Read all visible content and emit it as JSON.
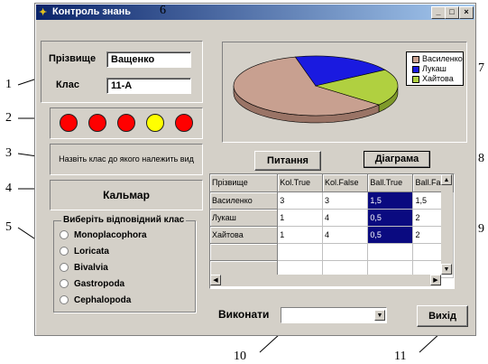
{
  "window": {
    "title": "Контроль знань",
    "controls": [
      "_",
      "□",
      "×"
    ]
  },
  "form": {
    "surname_label": "Прізвище",
    "surname_value": "Ващенко",
    "class_label": "Клас",
    "class_value": "11-А"
  },
  "indicators": [
    {
      "color": "#ff0000"
    },
    {
      "color": "#ff0000"
    },
    {
      "color": "#ff0000"
    },
    {
      "color": "#ffff00"
    },
    {
      "color": "#ff0000"
    }
  ],
  "question_text": "Назвіть клас до якого належить вид",
  "species": "Кальмар",
  "classes_group": {
    "title": "Виберіть відповідний клас",
    "options": [
      "Monoplacophora",
      "Loricata",
      "Bivalvia",
      "Gastropoda",
      "Cephalopoda"
    ]
  },
  "chart_data": {
    "type": "pie",
    "series": [
      {
        "name": "Василенко",
        "values": [
          60
        ]
      },
      {
        "name": "Лукаш",
        "values": [
          20
        ]
      },
      {
        "name": "Хайтова",
        "values": [
          20
        ]
      }
    ],
    "colors": [
      "#c8a090",
      "#1a1ae0",
      "#b0d040"
    ],
    "legend_position": "top-right"
  },
  "legend": [
    "Василенко",
    "Лукаш",
    "Хайтова"
  ],
  "buttons": {
    "question": "Питання",
    "diagram": "Діаграма",
    "exit": "Вихід"
  },
  "grid": {
    "headers": [
      "Прізвище",
      "Kol.True",
      "Kol.False",
      "Ball.True",
      "Ball.False"
    ],
    "rows": [
      [
        "Василенко",
        "3",
        "3",
        "1,5",
        "1,5"
      ],
      [
        "Лукаш",
        "1",
        "4",
        "0,5",
        "2"
      ],
      [
        "Хайтова",
        "1",
        "4",
        "0,5",
        "2"
      ],
      [
        "",
        "",
        "",
        "",
        ""
      ],
      [
        "",
        "",
        "",
        "",
        ""
      ]
    ]
  },
  "execute_label": "Виконати",
  "execute_value": "",
  "callouts": [
    "1",
    "2",
    "3",
    "4",
    "5",
    "6",
    "7",
    "8",
    "9",
    "10",
    "11"
  ]
}
